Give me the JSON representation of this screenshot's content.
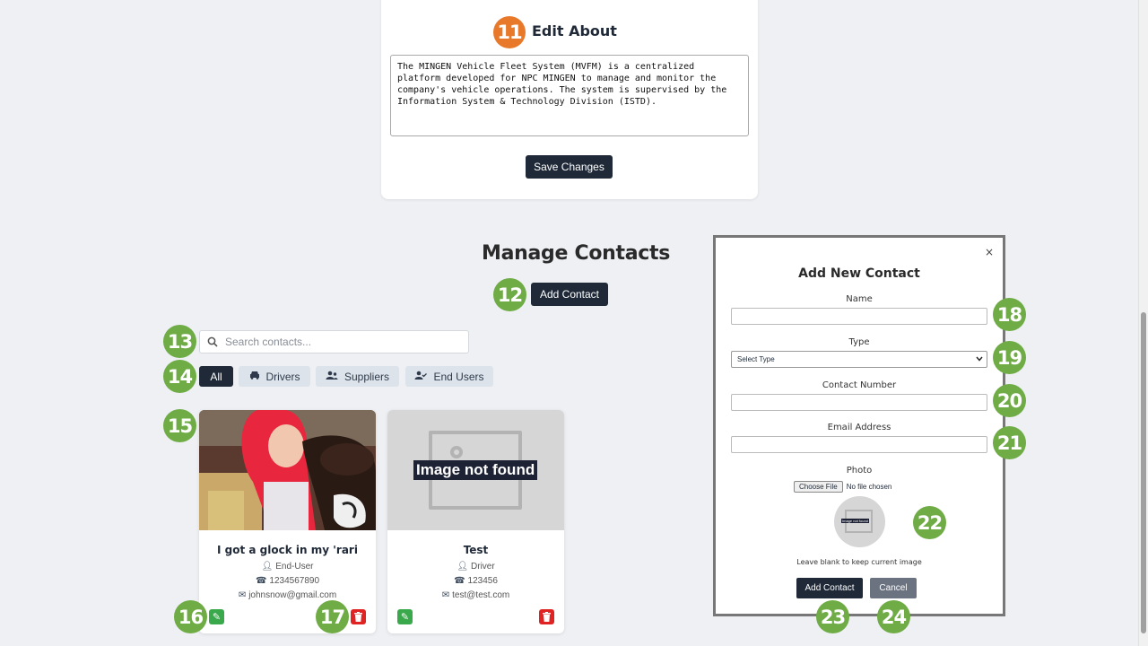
{
  "about": {
    "badge": "11",
    "title": "Edit About",
    "text": "The MINGEN Vehicle Fleet System (MVFM) is a centralized platform developed for NPC MINGEN to manage and monitor the company's vehicle operations. The system is supervised by the Information System & Technology Division (ISTD).",
    "save_label": "Save Changes"
  },
  "contacts": {
    "title": "Manage Contacts",
    "add_label": "Add Contact",
    "search_placeholder": "Search contacts...",
    "filters": [
      {
        "label": "All",
        "icon": "none"
      },
      {
        "label": "Drivers",
        "icon": "car-icon"
      },
      {
        "label": "Suppliers",
        "icon": "users-icon"
      },
      {
        "label": "End Users",
        "icon": "user-check-icon"
      }
    ],
    "cards": [
      {
        "name": "I got a glock in my 'rari",
        "type": "End-User",
        "phone": "1234567890",
        "email": "johnsnow@gmail.com",
        "photo": "photo"
      },
      {
        "name": "Test",
        "type": "Driver",
        "phone": "123456",
        "email": "test@test.com",
        "photo": "Image not found"
      }
    ]
  },
  "modal": {
    "title": "Add New Contact",
    "close": "×",
    "name_label": "Name",
    "type_label": "Type",
    "type_selected": "Select Type",
    "contact_label": "Contact Number",
    "email_label": "Email Address",
    "photo_label": "Photo",
    "choose_file": "Choose File",
    "no_file": "No file chosen",
    "avatar_text": "Image not found",
    "hint": "Leave blank to keep current image",
    "add_label": "Add Contact",
    "cancel_label": "Cancel"
  },
  "badges": {
    "b12": "12",
    "b13": "13",
    "b14": "14",
    "b15": "15",
    "b16": "16",
    "b17": "17",
    "b18": "18",
    "b19": "19",
    "b20": "20",
    "b21": "21",
    "b22": "22",
    "b23": "23",
    "b24": "24"
  },
  "colors": {
    "primary_dark": "#1f2937",
    "badge_orange": "#e8792a",
    "badge_green": "#6fac46",
    "edit_green": "#3aa94b",
    "delete_red": "#e02424",
    "cancel_gray": "#6b7280"
  }
}
